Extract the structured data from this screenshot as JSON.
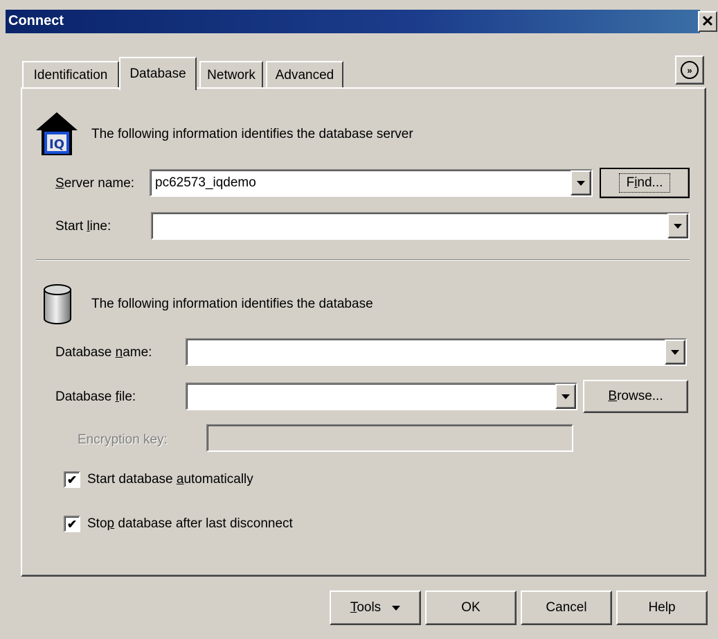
{
  "window": {
    "title": "Connect",
    "close_glyph": "✕"
  },
  "tabs": [
    {
      "label": "Identification",
      "active": false
    },
    {
      "label": "Database",
      "active": true
    },
    {
      "label": "Network",
      "active": false
    },
    {
      "label": "Advanced",
      "active": false
    }
  ],
  "expand_glyph": "»",
  "server_section": {
    "icon": "server-house-icon",
    "icon_text": "IQ",
    "description": "The following information identifies the database server",
    "server_name": {
      "label_pre": "",
      "label_mn": "S",
      "label_post": "erver name:",
      "value": "pc62573_iqdemo"
    },
    "find_button": {
      "label_pre": "F",
      "label_mn": "i",
      "label_post": "nd..."
    },
    "start_line": {
      "label_pre": "Start ",
      "label_mn": "l",
      "label_post": "ine:",
      "value": ""
    }
  },
  "database_section": {
    "icon": "database-cylinder-icon",
    "description": "The following information identifies the database",
    "database_name": {
      "label_pre": "Database ",
      "label_mn": "n",
      "label_post": "ame:",
      "value": ""
    },
    "database_file": {
      "label_pre": "Database ",
      "label_mn": "f",
      "label_post": "ile:",
      "value": ""
    },
    "browse_button": {
      "label_pre": "",
      "label_mn": "B",
      "label_post": "rowse..."
    },
    "encryption_key": {
      "label": "Encryption key:",
      "value": ""
    },
    "start_auto": {
      "label_pre": "Start database ",
      "label_mn": "a",
      "label_post": "utomatically",
      "checked": true
    },
    "stop_after": {
      "label_pre": "Sto",
      "label_mn": "p",
      "label_post": " database after last disconnect",
      "checked": true
    }
  },
  "footer": {
    "tools": {
      "label_pre": "",
      "label_mn": "T",
      "label_post": "ools"
    },
    "ok": "OK",
    "cancel": "Cancel",
    "help": "Help"
  },
  "colors": {
    "face": "#d4d0c8",
    "title_bar": "#0a246a",
    "field": "#ffffff",
    "disabled_text": "#808080"
  }
}
